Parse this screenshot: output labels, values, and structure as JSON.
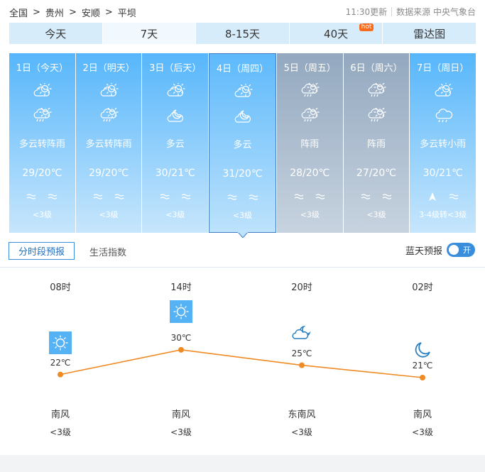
{
  "breadcrumb": [
    "全国",
    "贵州",
    "安顺",
    "平坝"
  ],
  "update": {
    "time": "11:30更新",
    "source": "数据来源 中央气象台"
  },
  "tabs": [
    {
      "label": "今天"
    },
    {
      "label": "7天"
    },
    {
      "label": "8-15天"
    },
    {
      "label": "40天",
      "badge": "hot"
    },
    {
      "label": "雷达图"
    }
  ],
  "days": [
    {
      "date": "1日（今天）",
      "icon1": "partly-cloudy-icon",
      "icon2": "shower-icon",
      "desc": "多云转阵雨",
      "temp": "29/20℃",
      "wind": [
        "wave",
        "wave"
      ],
      "level": "<3级",
      "style": "blue"
    },
    {
      "date": "2日（明天）",
      "icon1": "partly-cloudy-icon",
      "icon2": "shower-icon",
      "desc": "多云转阵雨",
      "temp": "29/20℃",
      "wind": [
        "wave",
        "wave"
      ],
      "level": "<3级",
      "style": "blue"
    },
    {
      "date": "3日（后天）",
      "icon1": "partly-cloudy-icon",
      "icon2": "partly-cloudy-night-icon",
      "desc": "多云",
      "temp": "30/21℃",
      "wind": [
        "wave",
        "wave"
      ],
      "level": "<3级",
      "style": "blue"
    },
    {
      "date": "4日（周四）",
      "icon1": "partly-cloudy-icon",
      "icon2": "partly-cloudy-night-icon",
      "desc": "多云",
      "temp": "31/20℃",
      "wind": [
        "wave",
        "wave"
      ],
      "level": "<3级",
      "style": "selected"
    },
    {
      "date": "5日（周五）",
      "icon1": "shower-icon",
      "icon2": "shower-icon",
      "desc": "阵雨",
      "temp": "28/20℃",
      "wind": [
        "wave",
        "wave"
      ],
      "level": "<3级",
      "style": "gray"
    },
    {
      "date": "6日（周六）",
      "icon1": "shower-icon",
      "icon2": "shower-icon",
      "desc": "阵雨",
      "temp": "27/20℃",
      "wind": [
        "wave",
        "wave"
      ],
      "level": "<3级",
      "style": "gray"
    },
    {
      "date": "7日（周日）",
      "icon1": "partly-cloudy-icon",
      "icon2": "light-rain-icon",
      "desc": "多云转小雨",
      "temp": "30/21℃",
      "wind": [
        "arrow",
        "wave"
      ],
      "level": "3-4级转<3级",
      "style": "blue"
    }
  ],
  "subtabs": {
    "active": "分时段预报",
    "other": "生活指数"
  },
  "bluesky": {
    "label": "蓝天预报",
    "toggle": "开"
  },
  "hourly": [
    {
      "time": "08时",
      "icon": "sun-icon",
      "temp": "22℃",
      "value": 22,
      "wind": "南风",
      "level": "<3级"
    },
    {
      "time": "14时",
      "icon": "sun-icon",
      "temp": "30℃",
      "value": 30,
      "wind": "南风",
      "level": "<3级"
    },
    {
      "time": "20时",
      "icon": "cloudy-night-icon",
      "temp": "25℃",
      "value": 25,
      "wind": "东南风",
      "level": "<3级"
    },
    {
      "time": "02时",
      "icon": "moon-icon",
      "temp": "21℃",
      "value": 21,
      "wind": "南风",
      "level": "<3级"
    }
  ],
  "colors": {
    "line": "#f08a24",
    "accent": "#3a8ddb",
    "sun_bg": "#55b3f5"
  }
}
